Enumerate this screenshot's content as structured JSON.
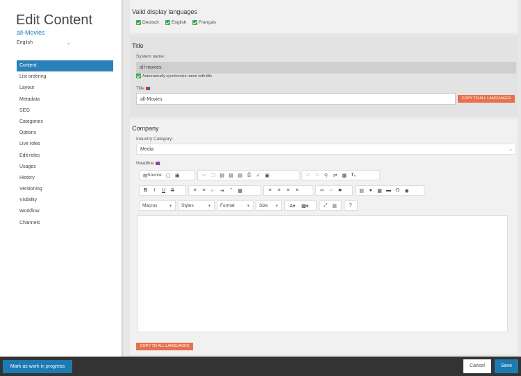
{
  "sidebar": {
    "title": "Edit Content",
    "subtitle": "all-Movies",
    "language": "English",
    "items": [
      {
        "label": "Content",
        "active": true
      },
      {
        "label": "List ordering"
      },
      {
        "label": "Layout"
      },
      {
        "label": "Metadata"
      },
      {
        "label": "SEO"
      },
      {
        "label": "Categories"
      },
      {
        "label": "Options"
      },
      {
        "label": "Live roles"
      },
      {
        "label": "Edit roles"
      },
      {
        "label": "Usages"
      },
      {
        "label": "History"
      },
      {
        "label": "Versioning"
      },
      {
        "label": "Visibility"
      },
      {
        "label": "Workflow"
      },
      {
        "label": "Channels"
      }
    ]
  },
  "languages": {
    "heading": "Valid display languages",
    "options": [
      "Deutsch",
      "English",
      "Français"
    ]
  },
  "title_section": {
    "heading": "Title",
    "system_name_label": "System name:",
    "system_name_value": "all-movies",
    "sync_label": "Automatically synchronize name with title",
    "title_label": "Title",
    "title_suffix": ":",
    "title_value": "all-Movies",
    "copy_button": "COPY TO ALL LANGUAGES"
  },
  "company_section": {
    "heading": "Company",
    "industry_label": "Industry Category:",
    "industry_value": "Media",
    "headline_label": "Headline",
    "headline_suffix": ":",
    "copy_button": "COPY TO ALL LANGUAGES"
  },
  "toolbar": {
    "source_label": "Source",
    "macros": "Macros",
    "styles": "Styles",
    "format": "Format",
    "size": "Size",
    "bold": "B",
    "italic": "I",
    "underline": "U",
    "strike": "S",
    "help": "?"
  },
  "bottom": {
    "wip_button": "Mark as work in progress",
    "cancel_button": "Cancel",
    "save_button": "Save"
  },
  "colors": {
    "accent_blue": "#1c7bb3",
    "nav_active": "#2a80b9",
    "orange": "#e8704a",
    "check_green": "#3da94d"
  }
}
